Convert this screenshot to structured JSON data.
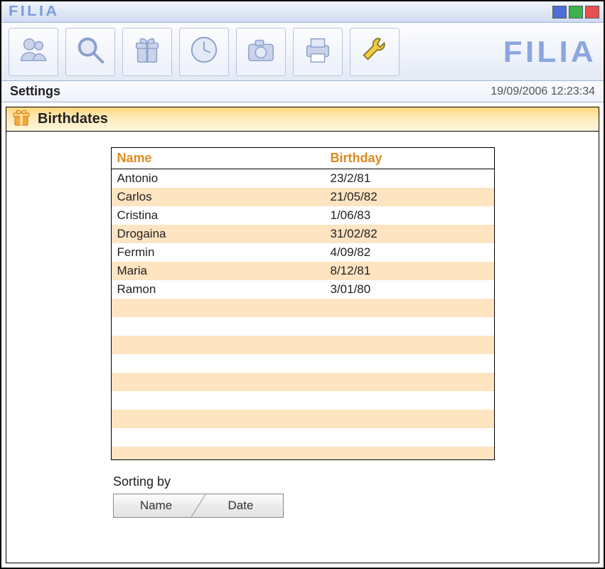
{
  "titlebar": {
    "logo_text": "FILIA"
  },
  "brand": {
    "text": "FILIA"
  },
  "subnav": {
    "title": "Settings",
    "datetime": "19/09/2006 12:23:34"
  },
  "panel": {
    "title": "Birthdates"
  },
  "table": {
    "headers": {
      "name": "Name",
      "birthday": "Birthday"
    },
    "rows": [
      {
        "name": "Antonio",
        "birthday": "23/2/81"
      },
      {
        "name": "Carlos",
        "birthday": "21/05/82"
      },
      {
        "name": "Cristina",
        "birthday": "1/06/83"
      },
      {
        "name": "Drogaina",
        "birthday": "31/02/82"
      },
      {
        "name": "Fermin",
        "birthday": "4/09/82"
      },
      {
        "name": "Maria",
        "birthday": "8/12/81"
      },
      {
        "name": "Ramon",
        "birthday": "3/01/80"
      }
    ],
    "empty_row_count": 9
  },
  "sorting": {
    "label": "Sorting by",
    "by_name": "Name",
    "by_date": "Date"
  },
  "icons": {
    "toolbar": [
      "people-icon",
      "search-icon",
      "gift-box-icon",
      "clock-icon",
      "camera-icon",
      "printer-icon",
      "wrench-icon"
    ]
  }
}
